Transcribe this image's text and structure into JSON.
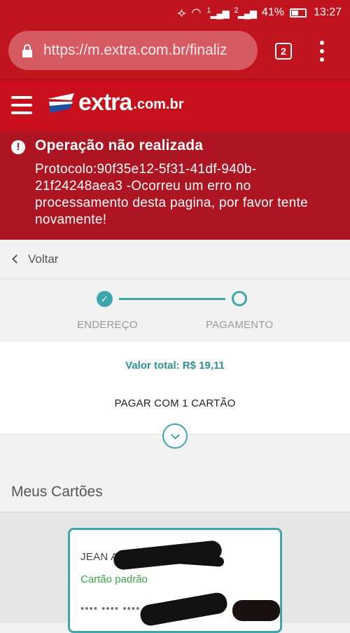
{
  "status_bar": {
    "battery": "41%",
    "time": "13:27",
    "sim1": "1",
    "sim2": "2"
  },
  "browser": {
    "url": "https://m.extra.com.br/finaliz",
    "tab_count": "2"
  },
  "header": {
    "logo_main": "extra",
    "logo_domain": ".com.br"
  },
  "alert": {
    "title": "Operação não realizada",
    "message": "Protocolo:90f35e12-5f31-41df-940b-21f24248aea3 -Ocorreu um erro no processamento desta pagina, por favor tente novamente!"
  },
  "nav": {
    "back_label": "Voltar"
  },
  "steps": {
    "items": [
      {
        "label": "ENDEREÇO",
        "state": "done"
      },
      {
        "label": "PAGAMENTO",
        "state": "current"
      }
    ]
  },
  "payment": {
    "total": "Valor total: R$ 19,11",
    "mode": "PAGAR COM 1 CARTÃO"
  },
  "cards": {
    "section_title": "Meus Cartões",
    "card": {
      "holder": "JEAN A",
      "status": "Cartão padrão",
      "number_masked": "•••• •••• ••••"
    }
  },
  "colors": {
    "brand_red": "#c8101d",
    "alert_red": "#ae1523",
    "accent_teal": "#3ea6ad",
    "success_green": "#3aa64c"
  }
}
